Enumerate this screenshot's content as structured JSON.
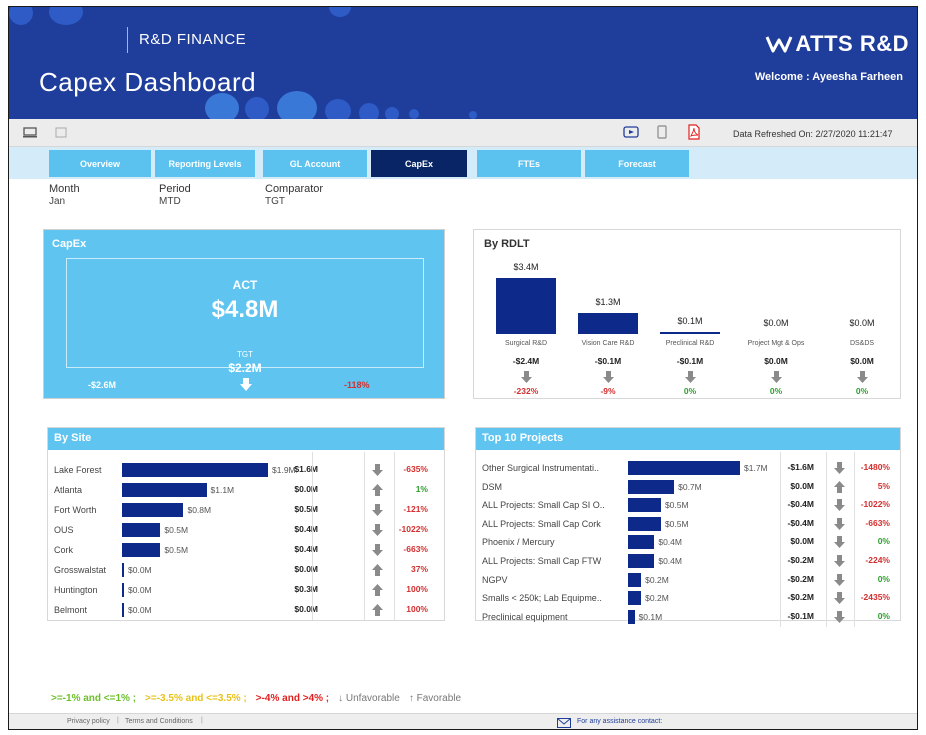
{
  "header": {
    "subtitle": "R&D FINANCE",
    "title": "Capex Dashboard",
    "brand": "ATTS R&D",
    "welcome": "Welcome : Ayeesha Farheen",
    "bg_color": "#1f3d9a"
  },
  "toolbar": {
    "refresh_label": "Data Refreshed On: 2/27/2020 11:21:47",
    "icons": [
      "desktop-icon",
      "tablet-icon",
      "present-icon",
      "mobile-icon",
      "pdf-icon"
    ]
  },
  "tabs": [
    {
      "label": "Overview",
      "active": false
    },
    {
      "label": "Reporting Levels",
      "active": false
    },
    {
      "label": "GL Account",
      "active": false
    },
    {
      "label": "CapEx",
      "active": true
    },
    {
      "label": "FTEs",
      "active": false
    },
    {
      "label": "Forecast",
      "active": false
    }
  ],
  "filters": [
    {
      "label": "Month",
      "value": "Jan"
    },
    {
      "label": "Period",
      "value": "MTD"
    },
    {
      "label": "Comparator",
      "value": "TGT"
    }
  ],
  "capex": {
    "title": "CapEx",
    "act_label": "ACT",
    "act_value": "$4.8M",
    "tgt_label": "TGT",
    "tgt_value": "$2.2M",
    "variance": "-$2.6M",
    "variance_pct": "-118%"
  },
  "rdlt": {
    "title": "By RDLT",
    "items": [
      {
        "name": "Surgical R&D",
        "value": "$3.4M",
        "amount": 3.4,
        "variance": "-$2.4M",
        "pct": "-232%",
        "pct_color": "#d32f2f"
      },
      {
        "name": "Vision Care R&D",
        "value": "$1.3M",
        "amount": 1.3,
        "variance": "-$0.1M",
        "pct": "-9%",
        "pct_color": "#d32f2f"
      },
      {
        "name": "Preclinical R&D",
        "value": "$0.1M",
        "amount": 0.1,
        "variance": "-$0.1M",
        "pct": "0%",
        "pct_color": "#2e9e2e"
      },
      {
        "name": "Project Mgt & Ops",
        "value": "$0.0M",
        "amount": 0.0,
        "variance": "$0.0M",
        "pct": "0%",
        "pct_color": "#2e9e2e"
      },
      {
        "name": "DS&DS",
        "value": "$0.0M",
        "amount": 0.0,
        "variance": "$0.0M",
        "pct": "0%",
        "pct_color": "#2e9e2e"
      }
    ]
  },
  "by_site": {
    "title": "By Site",
    "rows": [
      {
        "name": "Lake Forest",
        "amount": 1.9,
        "value": "$1.9M",
        "variance": "$1.6M",
        "dir": "down",
        "pct": "-635%",
        "pct_color": "#d32f2f"
      },
      {
        "name": "Atlanta",
        "amount": 1.1,
        "value": "$1.1M",
        "variance": "$0.0M",
        "dir": "up",
        "pct": "1%",
        "pct_color": "#2e9e2e"
      },
      {
        "name": "Fort Worth",
        "amount": 0.8,
        "value": "$0.8M",
        "variance": "$0.5M",
        "dir": "down",
        "pct": "-121%",
        "pct_color": "#d32f2f"
      },
      {
        "name": "OUS",
        "amount": 0.5,
        "value": "$0.5M",
        "variance": "$0.4M",
        "dir": "down",
        "pct": "-1022%",
        "pct_color": "#d32f2f"
      },
      {
        "name": "Cork",
        "amount": 0.5,
        "value": "$0.5M",
        "variance": "$0.4M",
        "dir": "down",
        "pct": "-663%",
        "pct_color": "#d32f2f"
      },
      {
        "name": "Grosswalstat",
        "amount": 0.0,
        "value": "$0.0M",
        "variance": "$0.0M",
        "dir": "up",
        "pct": "37%",
        "pct_color": "#d32f2f"
      },
      {
        "name": "Huntington",
        "amount": 0.0,
        "value": "$0.0M",
        "variance": "$0.3M",
        "dir": "up",
        "pct": "100%",
        "pct_color": "#d32f2f"
      },
      {
        "name": "Belmont",
        "amount": 0.0,
        "value": "$0.0M",
        "variance": "$0.0M",
        "dir": "up",
        "pct": "100%",
        "pct_color": "#d32f2f"
      }
    ]
  },
  "top_projects": {
    "title": "Top 10 Projects",
    "rows": [
      {
        "name": "Other Surgical Instrumentati..",
        "amount": 1.7,
        "value": "$1.7M",
        "variance": "-$1.6M",
        "dir": "down",
        "pct": "-1480%",
        "pct_color": "#d32f2f"
      },
      {
        "name": "DSM",
        "amount": 0.7,
        "value": "$0.7M",
        "variance": "$0.0M",
        "dir": "up",
        "pct": "5%",
        "pct_color": "#d32f2f"
      },
      {
        "name": "ALL Projects: Small Cap SI O..",
        "amount": 0.5,
        "value": "$0.5M",
        "variance": "-$0.4M",
        "dir": "down",
        "pct": "-1022%",
        "pct_color": "#d32f2f"
      },
      {
        "name": "ALL Projects: Small Cap Cork",
        "amount": 0.5,
        "value": "$0.5M",
        "variance": "-$0.4M",
        "dir": "down",
        "pct": "-663%",
        "pct_color": "#d32f2f"
      },
      {
        "name": "Phoenix / Mercury",
        "amount": 0.4,
        "value": "$0.4M",
        "variance": "$0.0M",
        "dir": "down",
        "pct": "0%",
        "pct_color": "#2e9e2e"
      },
      {
        "name": "ALL Projects: Small Cap FTW",
        "amount": 0.4,
        "value": "$0.4M",
        "variance": "-$0.2M",
        "dir": "down",
        "pct": "-224%",
        "pct_color": "#d32f2f"
      },
      {
        "name": "NGPV",
        "amount": 0.2,
        "value": "$0.2M",
        "variance": "-$0.2M",
        "dir": "down",
        "pct": "0%",
        "pct_color": "#2e9e2e"
      },
      {
        "name": "Smalls < 250k; Lab Equipme..",
        "amount": 0.2,
        "value": "$0.2M",
        "variance": "-$0.2M",
        "dir": "down",
        "pct": "-2435%",
        "pct_color": "#d32f2f"
      },
      {
        "name": "Preclinical equipment",
        "amount": 0.1,
        "value": "$0.1M",
        "variance": "-$0.1M",
        "dir": "down",
        "pct": "0%",
        "pct_color": "#2e9e2e"
      }
    ]
  },
  "legend": [
    {
      "text": ">=-1% and <=1% ;",
      "color": "#6cbf2a"
    },
    {
      "text": ">=-3.5% and <=3.5% ;",
      "color": "#e8c21a"
    },
    {
      "text": ">-4% and >4% ;",
      "color": "#e02020"
    },
    {
      "text": "↓ Unfavorable",
      "color": "#777777"
    },
    {
      "text": "↑ Favorable",
      "color": "#777777"
    }
  ],
  "footer": {
    "privacy": "Privacy policy",
    "terms": "Terms and Conditions",
    "contact": "For any assistance contact:"
  }
}
